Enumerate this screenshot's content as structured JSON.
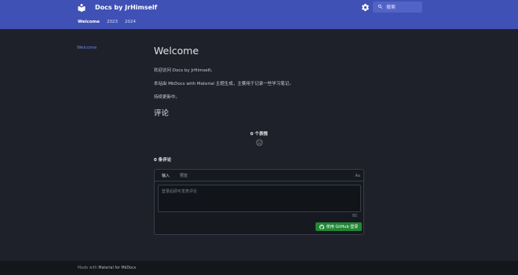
{
  "header": {
    "site_title": "Docs by JrHimself",
    "search_placeholder": "搜索",
    "logo_icon": "book-icon",
    "settings_icon": "gear-icon",
    "bg_color": "#4051b5"
  },
  "tabs": [
    {
      "label": "Welcome",
      "active": true
    },
    {
      "label": "2023",
      "active": false
    },
    {
      "label": "2024",
      "active": false
    }
  ],
  "sidebar": {
    "items": [
      {
        "label": "Welcome"
      }
    ]
  },
  "main": {
    "title": "Welcome",
    "paragraphs": [
      "欢迎访问 Docs by JrHimself。",
      "本站由 MkDocs with Material 主题生成，主要用于记录一些学习笔记。",
      "持续更新中。"
    ],
    "comments_heading": "评论"
  },
  "comments": {
    "reactions_label": "0 个表情",
    "comment_count": "0 条评论",
    "tabs": {
      "write": "输入",
      "preview": "预览"
    },
    "aa_label": "Aa",
    "textarea_placeholder": "登录后即可发表评论",
    "login_button": "使用 GitHub 登录",
    "login_button_color": "#238636"
  },
  "footer": {
    "made_with": "Made with",
    "link": "Material for MkDocs"
  }
}
